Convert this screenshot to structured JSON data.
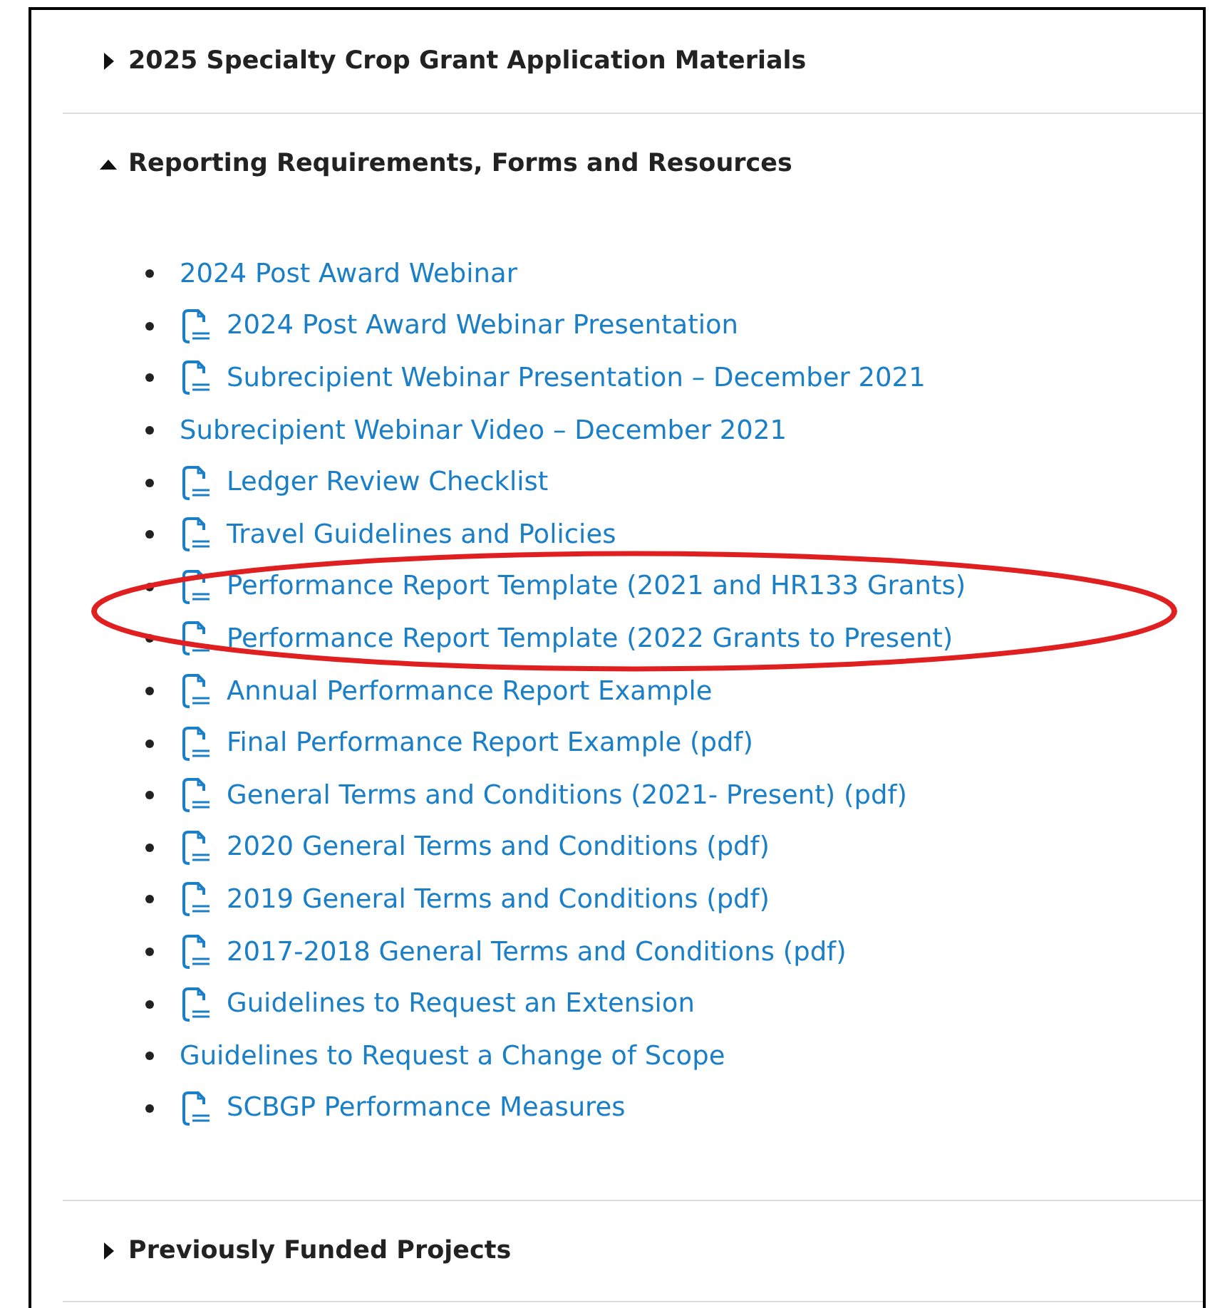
{
  "sections": [
    {
      "title": "2025 Specialty Crop Grant Application Materials",
      "expanded": false
    },
    {
      "title": "Reporting Requirements, Forms and Resources",
      "expanded": true,
      "items": [
        {
          "text": "2024 Post Award Webinar",
          "kind": "link"
        },
        {
          "text": "2024 Post Award Webinar Presentation",
          "kind": "pdf"
        },
        {
          "text": "Subrecipient Webinar Presentation – December 2021",
          "kind": "pdf"
        },
        {
          "text": "Subrecipient Webinar Video – December 2021",
          "kind": "link"
        },
        {
          "text": "Ledger Review Checklist",
          "kind": "pdf"
        },
        {
          "text": "Travel Guidelines and Policies",
          "kind": "pdf"
        },
        {
          "text": "Performance Report Template (2021 and HR133 Grants)",
          "kind": "pdf"
        },
        {
          "text": "Performance Report Template (2022 Grants to Present)",
          "kind": "pdf"
        },
        {
          "text": "Annual Performance Report Example",
          "kind": "pdf"
        },
        {
          "text": "Final Performance Report Example (pdf)",
          "kind": "pdf"
        },
        {
          "text": "General Terms and Conditions  (2021- Present) (pdf)",
          "kind": "pdf"
        },
        {
          "text": "2020 General Terms and Conditions (pdf)",
          "kind": "pdf"
        },
        {
          "text": "2019 General Terms and Conditions (pdf)",
          "kind": "pdf"
        },
        {
          "text": "2017-2018 General Terms and Conditions (pdf)",
          "kind": "pdf"
        },
        {
          "text": "Guidelines to Request an Extension",
          "kind": "pdf"
        },
        {
          "text": "Guidelines to Request a Change of Scope",
          "kind": "link"
        },
        {
          "text": "SCBGP Performance Measures",
          "kind": "pdf"
        }
      ]
    },
    {
      "title": "Previously Funded Projects",
      "expanded": false
    }
  ]
}
